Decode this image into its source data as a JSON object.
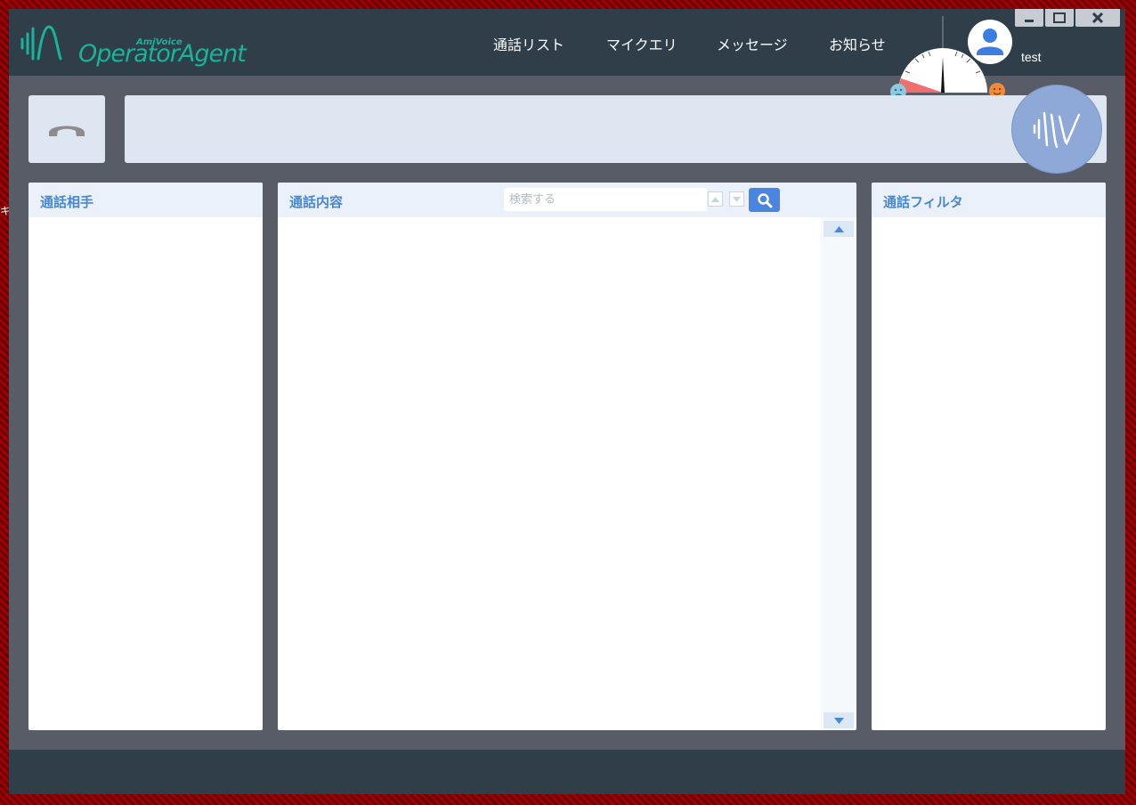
{
  "app": {
    "brand_small": "AmiVoice",
    "brand_name": "OperatorAgent"
  },
  "nav": [
    {
      "label": "通話リスト"
    },
    {
      "label": "マイクエリ"
    },
    {
      "label": "メッセージ"
    },
    {
      "label": "お知らせ"
    }
  ],
  "user": {
    "name": "test"
  },
  "desktop_edge_text": "キ",
  "icons": {
    "hangup": "phone-hangup-icon",
    "voice": "voice-wave-icon",
    "search": "search-icon",
    "sad": "sad-face-icon",
    "happy": "happy-face-icon",
    "user": "user-icon"
  },
  "panels": {
    "left": {
      "title": "通話相手"
    },
    "center": {
      "title": "通話内容",
      "search_placeholder": "検索する"
    },
    "right": {
      "title": "通話フィルタ"
    }
  },
  "colors": {
    "brand": "#18b49a",
    "accent": "#4a86e0",
    "titlebar": "#2f3e49"
  }
}
